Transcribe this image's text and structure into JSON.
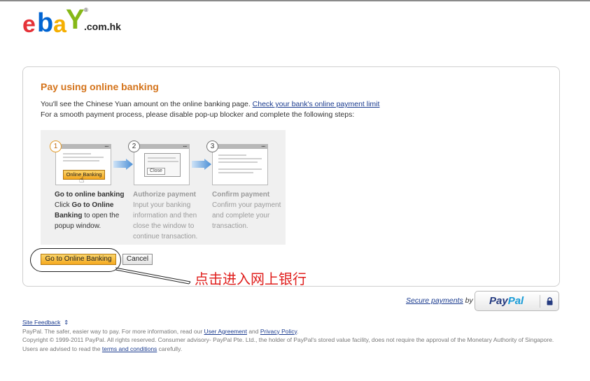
{
  "logo": {
    "letters": [
      "e",
      "b",
      "a",
      "Y"
    ],
    "registered": "®",
    "suffix": ".com.hk",
    "colors": {
      "e": "#e53238",
      "b": "#0064d2",
      "a": "#f5af02",
      "y": "#86b817"
    }
  },
  "page": {
    "title": "Pay using online banking",
    "line1_text": "You'll see the Chinese Yuan amount on the online banking page. ",
    "line1_link": "Check your bank's online payment limit",
    "line2_text": "For a smooth payment process, please disable pop-up blocker and complete the following steps:"
  },
  "steps": [
    {
      "number": "1",
      "heading": "Go to online banking",
      "desc_prefix": "Click ",
      "desc_bold": "Go to Online Banking",
      "desc_suffix": " to open the popup window.",
      "button_label": "Online Banking",
      "icon": "hand-pointer-icon"
    },
    {
      "number": "2",
      "heading": "Authorize payment",
      "desc": "Input your banking information and then close the window to continue transaction.",
      "button_label": "Close"
    },
    {
      "number": "3",
      "heading": "Confirm payment",
      "desc": "Confirm your payment and complete your transaction."
    }
  ],
  "actions": {
    "go_label": "Go to Online Banking",
    "cancel_label": "Cancel"
  },
  "annotation": {
    "text": "点击进入网上银行",
    "color": "#e0201e"
  },
  "secure": {
    "link": "Secure payments",
    "by": " by",
    "badge_pay": "Pay",
    "badge_pal": "Pal",
    "badge_icon": "lock-icon"
  },
  "footer": {
    "feedback": "Site Feedback",
    "feedback_icon": "feedback-icon",
    "line1_prefix": "PayPal. The safer, easier way to pay. For more information, read our ",
    "user_agreement": "User Agreement",
    "and1": " and ",
    "privacy": "Privacy Policy",
    "dot": ".",
    "line2_prefix": "Copyright © 1999-2011 PayPal. All rights reserved. Consumer advisory- PayPal Pte. Ltd., the holder of PayPal's stored value facility, does not require the approval of the Monetary Authority of Singapore. Users are advised to read the ",
    "terms": "terms and conditions",
    "line2_suffix": " carefully."
  }
}
